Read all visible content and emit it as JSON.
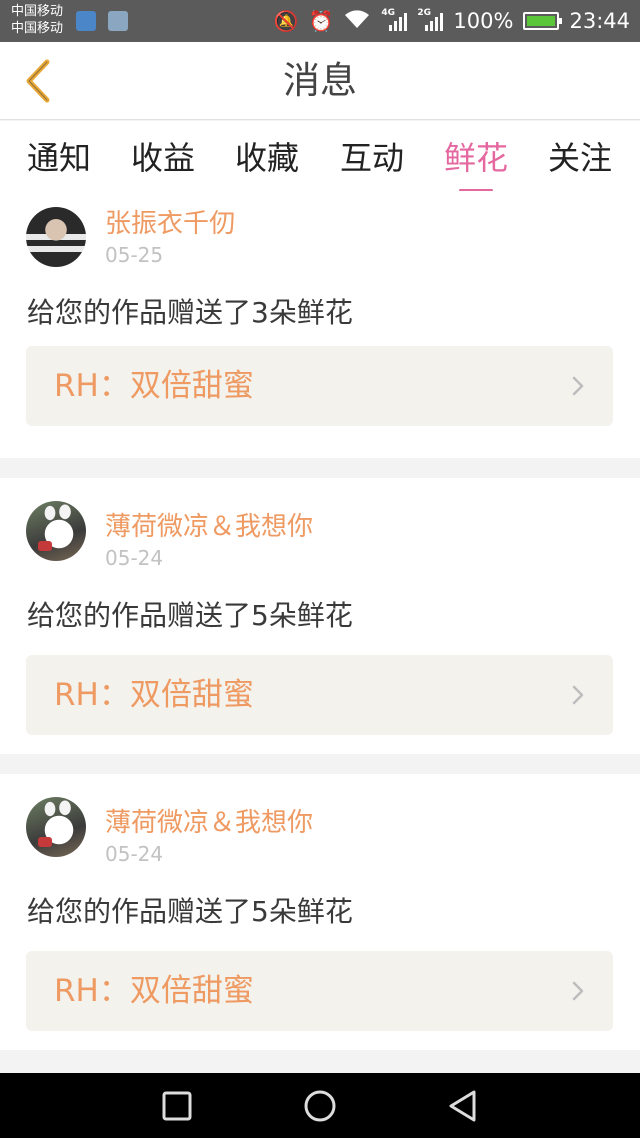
{
  "status_bar": {
    "carrier_1": "中国移动",
    "carrier_2": "中国移动",
    "network_1": "4G",
    "network_2": "2G",
    "battery": "100%",
    "time": "23:44"
  },
  "header": {
    "title": "消息",
    "back_icon": "chevron-left-icon"
  },
  "tabs": [
    {
      "label": "通知",
      "active": false
    },
    {
      "label": "收益",
      "active": false
    },
    {
      "label": "收藏",
      "active": false
    },
    {
      "label": "互动",
      "active": false
    },
    {
      "label": "鲜花",
      "active": true
    },
    {
      "label": "关注",
      "active": false
    }
  ],
  "messages": [
    {
      "user": "张振衣千仞",
      "date": "05-25",
      "text": "给您的作品赠送了3朵鲜花",
      "work": "RH：双倍甜蜜"
    },
    {
      "user": "薄荷微凉＆我想你",
      "date": "05-24",
      "text": "给您的作品赠送了5朵鲜花",
      "work": "RH：双倍甜蜜"
    },
    {
      "user": "薄荷微凉＆我想你",
      "date": "05-24",
      "text": "给您的作品赠送了5朵鲜花",
      "work": "RH：双倍甜蜜"
    }
  ],
  "colors": {
    "accent_tab": "#e5679f",
    "username": "#ee9a62",
    "back_icon": "#e8a838"
  },
  "navbar": {
    "icons": [
      "recent-apps-icon",
      "home-icon",
      "back-icon"
    ]
  }
}
